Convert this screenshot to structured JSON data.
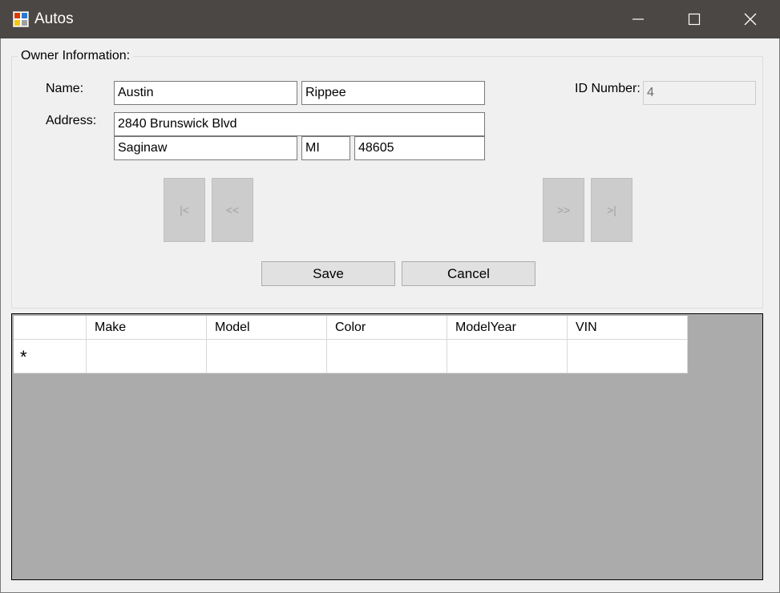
{
  "window": {
    "title": "Autos",
    "icon": "app-icon",
    "controls": [
      "minimize-icon",
      "maximize-icon",
      "close-icon"
    ]
  },
  "owner": {
    "group_title": "Owner Information:",
    "name_label": "Name:",
    "first_name": "Austin",
    "last_name": "Rippee",
    "id_label": "ID Number:",
    "id_value": "4",
    "address_label": "Address:",
    "street": "2840 Brunswick Blvd",
    "city": "Saginaw",
    "state": "MI",
    "zip": "48605"
  },
  "nav": {
    "first": "|<",
    "prev": "<<",
    "next": ">>",
    "last": ">|"
  },
  "actions": {
    "save": "Save",
    "cancel": "Cancel"
  },
  "grid": {
    "columns": [
      "Make",
      "Model",
      "Color",
      "ModelYear",
      "VIN"
    ],
    "new_row_marker": "*",
    "rows": []
  },
  "colors": {
    "titlebar": "#4b4744",
    "grid_background": "#ababab",
    "form_background": "#f0f0f0"
  }
}
